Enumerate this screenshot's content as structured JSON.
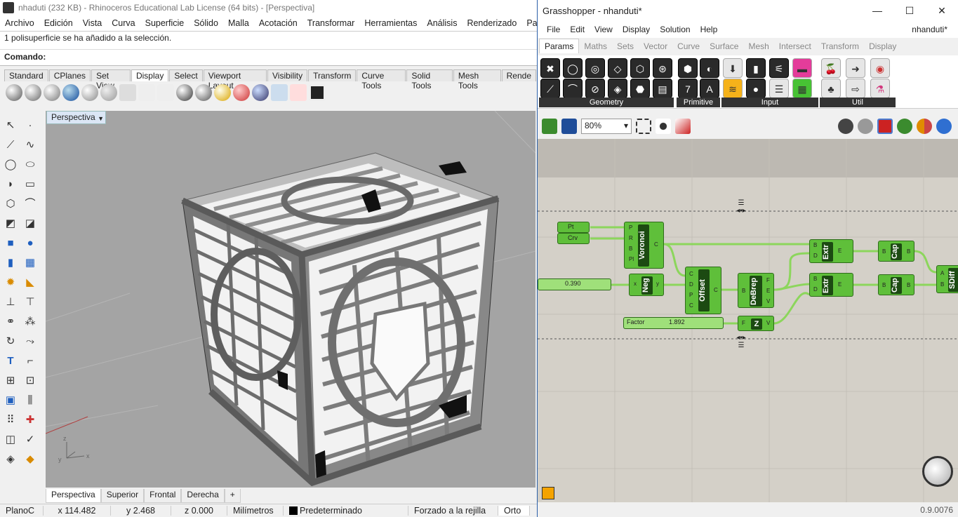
{
  "rhino": {
    "title": "nhaduti (232 KB) - Rhinoceros Educational Lab License (64 bits) - [Perspectiva]",
    "menu": [
      "Archivo",
      "Edición",
      "Vista",
      "Curva",
      "Superficie",
      "Sólido",
      "Malla",
      "Acotación",
      "Transformar",
      "Herramientas",
      "Análisis",
      "Renderizado",
      "Paneles"
    ],
    "history": "1 polisuperficie se ha añadido a la selección.",
    "command_label": "Comando:",
    "toolbar_tabs": [
      "Standard",
      "CPlanes",
      "Set View",
      "Display",
      "Select",
      "Viewport Layout",
      "Visibility",
      "Transform",
      "Curve Tools",
      "Solid Tools",
      "Mesh Tools",
      "Rende"
    ],
    "active_tab": "Display",
    "viewport_name": "Perspectiva",
    "viewport_tabs": [
      "Perspectiva",
      "Superior",
      "Frontal",
      "Derecha",
      "+"
    ],
    "status": {
      "plane": "PlanoC",
      "x": "x 114.482",
      "y": "y 2.468",
      "z": "z 0.000",
      "units": "Milímetros",
      "layer": "Predeterminado",
      "snap": "Forzado a la rejilla",
      "ortho": "Orto"
    }
  },
  "gh": {
    "title": "Grasshopper - nhanduti*",
    "menu": [
      "File",
      "Edit",
      "View",
      "Display",
      "Solution",
      "Help"
    ],
    "doc_name": "nhanduti*",
    "tabs": [
      "Params",
      "Maths",
      "Sets",
      "Vector",
      "Curve",
      "Surface",
      "Mesh",
      "Intersect",
      "Transform",
      "Display"
    ],
    "active_tab": "Params",
    "ribbon_groups": [
      "Geometry",
      "Primitive",
      "Input",
      "Util"
    ],
    "zoom": "80%",
    "version": "0.9.0076",
    "components": {
      "pt": "Pt",
      "crv": "Crv",
      "voronoi": "Voronoi",
      "slider1_value": "0.390",
      "neg": "Neg",
      "offset": "Offset",
      "debrep": "DeBrep",
      "extr": "Extr",
      "cap": "Cap",
      "sdiff": "SDiff",
      "factor_label": "Factor",
      "slider2_value": "1.892",
      "z": "Z"
    }
  }
}
